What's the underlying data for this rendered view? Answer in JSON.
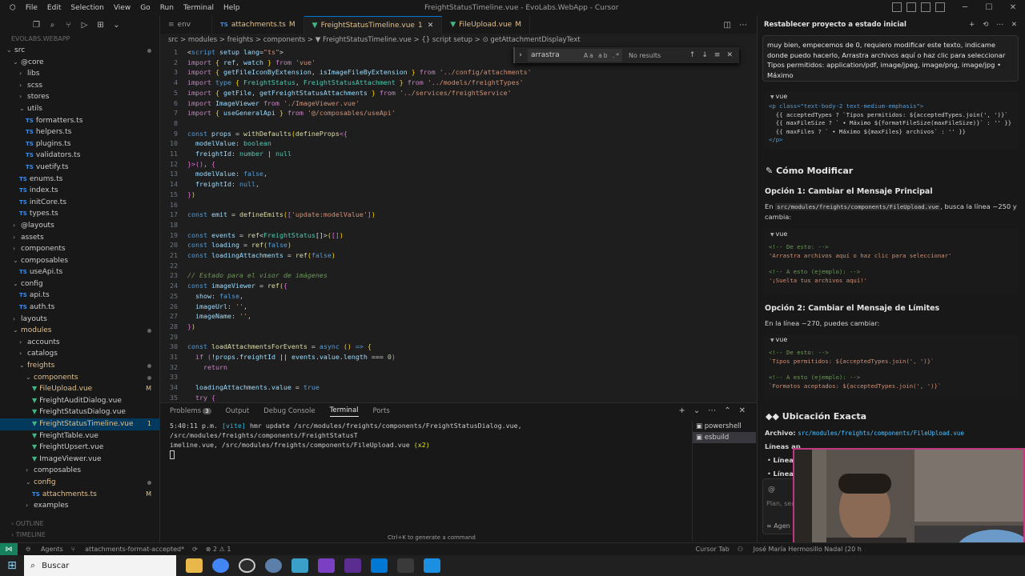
{
  "window": {
    "title": "FreightStatusTimeline.vue - EvoLabs.WebApp - Cursor",
    "menu": [
      "File",
      "Edit",
      "Selection",
      "View",
      "Go",
      "Run",
      "Terminal",
      "Help"
    ]
  },
  "sidebar": {
    "root": "EVOLABS.WEBAPP",
    "tree": [
      {
        "label": "src",
        "kind": "folder",
        "depth": 0,
        "open": true,
        "dot": true
      },
      {
        "label": "@core",
        "kind": "folder",
        "depth": 1,
        "open": true
      },
      {
        "label": "libs",
        "kind": "folder",
        "depth": 2
      },
      {
        "label": "scss",
        "kind": "folder",
        "depth": 2
      },
      {
        "label": "stores",
        "kind": "folder",
        "depth": 2
      },
      {
        "label": "utils",
        "kind": "folder",
        "depth": 2,
        "open": true
      },
      {
        "label": "formatters.ts",
        "kind": "ts",
        "depth": 3
      },
      {
        "label": "helpers.ts",
        "kind": "ts",
        "depth": 3
      },
      {
        "label": "plugins.ts",
        "kind": "ts",
        "depth": 3
      },
      {
        "label": "validators.ts",
        "kind": "ts",
        "depth": 3
      },
      {
        "label": "vuetify.ts",
        "kind": "ts",
        "depth": 3
      },
      {
        "label": "enums.ts",
        "kind": "ts",
        "depth": 2
      },
      {
        "label": "index.ts",
        "kind": "ts",
        "depth": 2
      },
      {
        "label": "initCore.ts",
        "kind": "ts",
        "depth": 2
      },
      {
        "label": "types.ts",
        "kind": "ts",
        "depth": 2
      },
      {
        "label": "@layouts",
        "kind": "folder",
        "depth": 1
      },
      {
        "label": "assets",
        "kind": "folder",
        "depth": 1
      },
      {
        "label": "components",
        "kind": "folder",
        "depth": 1
      },
      {
        "label": "composables",
        "kind": "folder",
        "depth": 1,
        "open": true
      },
      {
        "label": "useApi.ts",
        "kind": "ts",
        "depth": 2
      },
      {
        "label": "config",
        "kind": "folder",
        "depth": 1,
        "open": true
      },
      {
        "label": "api.ts",
        "kind": "ts",
        "depth": 2
      },
      {
        "label": "auth.ts",
        "kind": "ts",
        "depth": 2
      },
      {
        "label": "layouts",
        "kind": "folder",
        "depth": 1
      },
      {
        "label": "modules",
        "kind": "folder",
        "depth": 1,
        "open": true,
        "mod": true,
        "dot": true
      },
      {
        "label": "accounts",
        "kind": "folder",
        "depth": 2
      },
      {
        "label": "catalogs",
        "kind": "folder",
        "depth": 2
      },
      {
        "label": "freights",
        "kind": "folder",
        "depth": 2,
        "open": true,
        "mod": true,
        "dot": true
      },
      {
        "label": "components",
        "kind": "folder",
        "depth": 3,
        "open": true,
        "mod": true,
        "dot": true
      },
      {
        "label": "FileUpload.vue",
        "kind": "vue",
        "depth": 4,
        "mod": true,
        "badge": "M"
      },
      {
        "label": "FreightAuditDialog.vue",
        "kind": "vue",
        "depth": 4
      },
      {
        "label": "FreightStatusDialog.vue",
        "kind": "vue",
        "depth": 4
      },
      {
        "label": "FreightStatusTimeline.vue",
        "kind": "vue",
        "depth": 4,
        "mod": true,
        "badge": "1",
        "selected": true
      },
      {
        "label": "FreightTable.vue",
        "kind": "vue",
        "depth": 4
      },
      {
        "label": "FreightUpsert.vue",
        "kind": "vue",
        "depth": 4
      },
      {
        "label": "ImageViewer.vue",
        "kind": "vue",
        "depth": 4
      },
      {
        "label": "composables",
        "kind": "folder",
        "depth": 3
      },
      {
        "label": "config",
        "kind": "folder",
        "depth": 3,
        "open": true,
        "mod": true,
        "dot": true
      },
      {
        "label": "attachments.ts",
        "kind": "ts",
        "depth": 4,
        "mod": true,
        "badge": "M"
      },
      {
        "label": "examples",
        "kind": "folder",
        "depth": 3
      }
    ],
    "outline": "OUTLINE",
    "timeline": "TIMELINE"
  },
  "tabs": [
    {
      "label": "env",
      "icon": "file",
      "active": false
    },
    {
      "label": "attachments.ts",
      "icon": "ts",
      "mod": "M",
      "active": false
    },
    {
      "label": "FreightStatusTimeline.vue",
      "icon": "vue",
      "mod": "1",
      "active": true
    },
    {
      "label": "FileUpload.vue",
      "icon": "vue",
      "mod": "M",
      "active": false
    }
  ],
  "breadcrumb": "src > modules > freights > components > ▼ FreightStatusTimeline.vue > {} script setup > ⊙ getAttachmentDisplayText",
  "find": {
    "query": "arrastra",
    "result": "No results",
    "options": "Aa ab .*"
  },
  "code": [
    {
      "n": 1,
      "h": "<span class='p'>&lt;</span><span class='k'>script</span> <span class='v'>setup</span> <span class='v'>lang</span><span class='p'>=</span><span class='s'>\"ts\"</span><span class='p'>&gt;</span>"
    },
    {
      "n": 2,
      "h": "<span class='kc'>import</span> <span class='b'>{</span> <span class='v'>ref</span>, <span class='v'>watch</span> <span class='b'>}</span> <span class='kc'>from</span> <span class='s'>'vue'</span>"
    },
    {
      "n": 3,
      "h": "<span class='kc'>import</span> <span class='b'>{</span> <span class='v'>getFileIconByExtension</span>, <span class='v'>isImageFileByExtension</span> <span class='b'>}</span> <span class='kc'>from</span> <span class='s'>'../config/attachments'</span>"
    },
    {
      "n": 4,
      "h": "<span class='kc'>import</span> <span class='k'>type</span> <span class='b'>{</span> <span class='t'>FreightStatus</span>, <span class='t'>FreightStatusAttachment</span> <span class='b'>}</span> <span class='kc'>from</span> <span class='s'>'../models/freightTypes'</span>"
    },
    {
      "n": 5,
      "h": "<span class='kc'>import</span> <span class='b'>{</span> <span class='v'>getFile</span>, <span class='v'>getFreightStatusAttachments</span> <span class='b'>}</span> <span class='kc'>from</span> <span class='s'>'../services/freightService'</span>"
    },
    {
      "n": 6,
      "h": "<span class='kc'>import</span> <span class='v'>ImageViewer</span> <span class='kc'>from</span> <span class='s'>'./ImageViewer.vue'</span>"
    },
    {
      "n": 7,
      "h": "<span class='kc'>import</span> <span class='b'>{</span> <span class='v'>useGeneralApi</span> <span class='b'>}</span> <span class='kc'>from</span> <span class='s'>'@/composables/useApi'</span>"
    },
    {
      "n": 8,
      "h": ""
    },
    {
      "n": 9,
      "h": "<span class='k'>const</span> <span class='v'>props</span> <span class='p'>=</span> <span class='f'>withDefaults</span><span class='b'>(</span><span class='f'>defineProps</span><span class='bb'>&lt;</span><span class='bb'>{</span>"
    },
    {
      "n": 10,
      "h": "  <span class='v'>modelValue</span>: <span class='t'>boolean</span>"
    },
    {
      "n": 11,
      "h": "  <span class='v'>freightId</span>: <span class='t'>number</span> <span class='p'>|</span> <span class='t'>null</span>"
    },
    {
      "n": 12,
      "h": "<span class='bb'>}&gt;</span><span class='bb'>()</span>, <span class='bb'>{</span>"
    },
    {
      "n": 13,
      "h": "  <span class='v'>modelValue</span>: <span class='k'>false</span>,"
    },
    {
      "n": 14,
      "h": "  <span class='v'>freightId</span>: <span class='k'>null</span>,"
    },
    {
      "n": 15,
      "h": "<span class='bb'>}</span><span class='b'>)</span>"
    },
    {
      "n": 16,
      "h": ""
    },
    {
      "n": 17,
      "h": "<span class='k'>const</span> <span class='v'>emit</span> <span class='p'>=</span> <span class='f'>defineEmits</span><span class='b'>(</span><span class='bb'>[</span><span class='s'>'update:modelValue'</span><span class='bb'>]</span><span class='b'>)</span>"
    },
    {
      "n": 18,
      "h": ""
    },
    {
      "n": 19,
      "h": "<span class='k'>const</span> <span class='v'>events</span> <span class='p'>=</span> <span class='f'>ref</span><span class='p'>&lt;</span><span class='t'>FreightStatus</span><span class='p'>[]&gt;</span><span class='b'>(</span><span class='bb'>[]</span><span class='b'>)</span>"
    },
    {
      "n": 20,
      "h": "<span class='k'>const</span> <span class='v'>loading</span> <span class='p'>=</span> <span class='f'>ref</span><span class='b'>(</span><span class='k'>false</span><span class='b'>)</span>"
    },
    {
      "n": 21,
      "h": "<span class='k'>const</span> <span class='v'>loadingAttachments</span> <span class='p'>=</span> <span class='f'>ref</span><span class='b'>(</span><span class='k'>false</span><span class='b'>)</span>"
    },
    {
      "n": 22,
      "h": ""
    },
    {
      "n": 23,
      "h": "<span class='c'>// Estado para el visor de imágenes</span>"
    },
    {
      "n": 24,
      "h": "<span class='k'>const</span> <span class='v'>imageViewer</span> <span class='p'>=</span> <span class='f'>ref</span><span class='b'>(</span><span class='bb'>{</span>"
    },
    {
      "n": 25,
      "h": "  <span class='v'>show</span>: <span class='k'>false</span>,"
    },
    {
      "n": 26,
      "h": "  <span class='v'>imageUrl</span>: <span class='s'>''</span>,"
    },
    {
      "n": 27,
      "h": "  <span class='v'>imageName</span>: <span class='s'>''</span>,"
    },
    {
      "n": 28,
      "h": "<span class='bb'>}</span><span class='b'>)</span>"
    },
    {
      "n": 29,
      "h": ""
    },
    {
      "n": 30,
      "h": "<span class='k'>const</span> <span class='f'>loadAttachmentsForEvents</span> <span class='p'>=</span> <span class='k'>async</span> <span class='b'>()</span> <span class='k'>=&gt;</span> <span class='b'>{</span>"
    },
    {
      "n": 31,
      "h": "  <span class='kc'>if</span> <span class='bb'>(</span><span class='p'>!</span><span class='v'>props</span>.<span class='v'>freightId</span> <span class='p'>||</span> <span class='v'>events</span>.<span class='v'>value</span>.<span class='v'>length</span> <span class='p'>===</span> <span class='n'>0</span><span class='bb'>)</span>"
    },
    {
      "n": 32,
      "h": "    <span class='kc'>return</span>"
    },
    {
      "n": 33,
      "h": ""
    },
    {
      "n": 34,
      "h": "  <span class='v'>loadingAttachments</span>.<span class='v'>value</span> <span class='p'>=</span> <span class='k'>true</span>"
    },
    {
      "n": 35,
      "h": "  <span class='kc'>try</span> <span class='bb'>{</span>"
    }
  ],
  "panel": {
    "tabs": [
      "Problems",
      "Output",
      "Debug Console",
      "Terminal",
      "Ports"
    ],
    "problems_count": "3",
    "terminal_line1_time": "5:40:11 p.m.",
    "terminal_line1_vite": "[vite]",
    "terminal_line1_rest": "hmr update /src/modules/freights/components/FreightStatusDialog.vue, /src/modules/freights/components/FreightStatusT",
    "terminal_line2": "imeline.vue, /src/modules/freights/components/FileUpload.vue",
    "terminal_line2_count": "(x2)",
    "terminals": [
      "powershell",
      "esbuild"
    ],
    "hint": "Ctrl+K to generate a command"
  },
  "chat": {
    "title": "Restablecer proyecto a estado inicial",
    "user_message": "muy bien, empecemos de 0, requiero modificar este texto, indicame donde puedo hacerlo, Arrastra archivos aquí o haz clic para seleccionar Tipos permitidos: application/pdf, image/jpeg, image/png, image/jpg • Máximo",
    "block1": {
      "lang": "vue",
      "lines": [
        "<p class=\"text-body-2 text-medium-emphasis\">",
        "  {{ acceptedTypes ? `Tipos permitidos: ${acceptedTypes.join(', ')}`",
        "  {{ maxFileSize ? ` • Máximo ${formatFileSize(maxFileSize)}` : '' }}",
        "  {{ maxFiles ? ` • Máximo ${maxFiles} archivos` : '' }}",
        "</p>"
      ]
    },
    "heading_modify": "Cómo Modificar",
    "option1_title": "Opción 1: Cambiar el Mensaje Principal",
    "option1_pre": "En",
    "option1_path": "src/modules/freights/components/FileUpload.vue",
    "option1_post": ", busca la línea ~250 y cambia:",
    "block2": {
      "lang": "vue",
      "c1": "<!-- De esto: -->",
      "s1": "'Arrastra archivos aquí o haz clic para seleccionar'",
      "c2": "<!-- A esto (ejemplo): -->",
      "s2": "'¡Suelta tus archivos aquí!'"
    },
    "option2_title": "Opción 2: Cambiar el Mensaje de Límites",
    "option2_text": "En la línea ~270, puedes cambiar:",
    "block3": {
      "lang": "vue",
      "c1": "<!-- De esto: -->",
      "s1": "`Tipos permitidos: ${acceptedTypes.join(', ')}`",
      "c2": "<!-- A esto (ejemplo): -->",
      "s2": "`Formatos aceptados: ${acceptedTypes.join(', ')}`"
    },
    "heading_location": "Ubicación Exacta",
    "archivo_label": "Archivo:",
    "archivo_path": "src/modules/freights/components/FileUpload.vue",
    "lineas_label": "Líneas ap",
    "bullet1": "Línea",
    "bullet2": "Línea",
    "composer_placeholder": "Plan, sea",
    "agent_label": "∞ Agen"
  },
  "statusbar": {
    "agents": "Agents",
    "branch": "attachments-format-accepted*",
    "problems": "⊗ 2 ⚠ 1",
    "cursor_tab": "Cursor Tab",
    "user": "José María Hermosillo Nadal (20 h"
  },
  "taskbar": {
    "search": "Buscar"
  },
  "colors": {
    "accent": "#0078d4",
    "modified": "#e2c08d",
    "remote": "#16825d"
  }
}
